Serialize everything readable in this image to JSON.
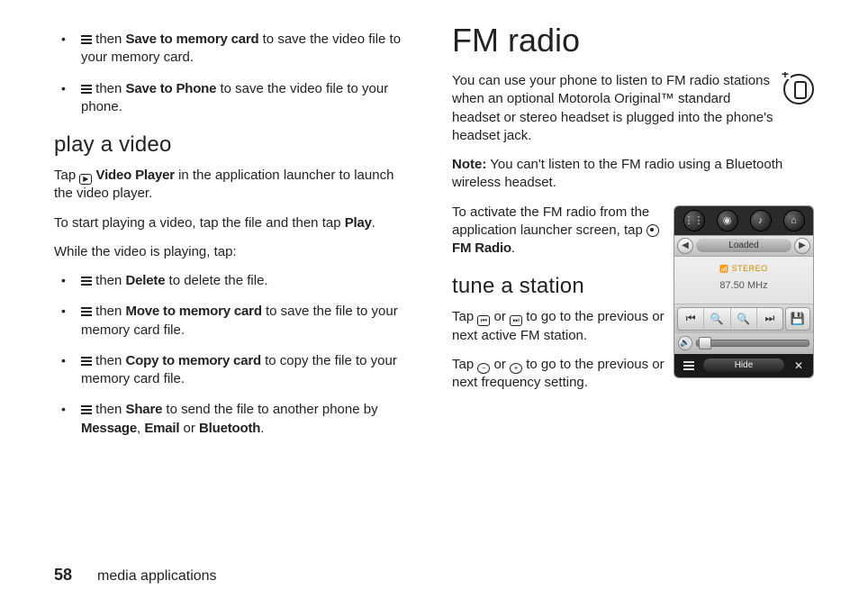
{
  "left": {
    "top_bullets": [
      {
        "action": "Save to memory card",
        "tail": " to save the video file to your memory card."
      },
      {
        "action": "Save to Phone",
        "tail": " to save the video file to your phone."
      }
    ],
    "play_heading": "play a video",
    "play_p1_pre": "Tap ",
    "play_p1_app": "Video Player",
    "play_p1_post": " in the application launcher to launch the video player.",
    "play_p2_pre": "To start playing a video, tap the file and then tap ",
    "play_p2_action": "Play",
    "play_p2_post": ".",
    "play_p3": "While the video is playing, tap:",
    "play_bullets": [
      {
        "action": "Delete",
        "tail": " to delete the file."
      },
      {
        "action": "Move to memory card",
        "tail": " to save the file to your memory card file."
      },
      {
        "action": "Copy to memory card",
        "tail": " to copy the file to your memory card file."
      },
      {
        "action": "Share",
        "tail": " to send the file to another phone by ",
        "extra": [
          "Message",
          "Email",
          "Bluetooth"
        ]
      }
    ]
  },
  "right": {
    "heading": "FM radio",
    "intro": "You can use your phone to listen to FM radio stations when an optional Motorola Original™ standard headset or stereo headset is plugged into the phone's headset jack.",
    "note_label": "Note:",
    "note_text": " You can't listen to the FM radio using a Bluetooth wireless headset.",
    "activate_pre": "To activate the FM radio from the application launcher screen, tap ",
    "activate_app": "FM Radio",
    "activate_post": ".",
    "tune_heading": "tune a station",
    "tune_p1_pre": "Tap ",
    "tune_p1_mid": " or ",
    "tune_p1_post": " to go to the previous or next active FM station.",
    "tune_p2_pre": "Tap ",
    "tune_p2_mid": " or ",
    "tune_p2_post": " to go to the previous or next frequency setting."
  },
  "fm": {
    "loaded": "Loaded",
    "stereo": "STEREO",
    "freq": "87.50 MHz",
    "hide": "Hide"
  },
  "footer": {
    "page": "58",
    "label": "media applications"
  },
  "glyph": {
    "then": " then ",
    "comma_sp": ", ",
    "or_sp": " or ",
    "period": "."
  }
}
